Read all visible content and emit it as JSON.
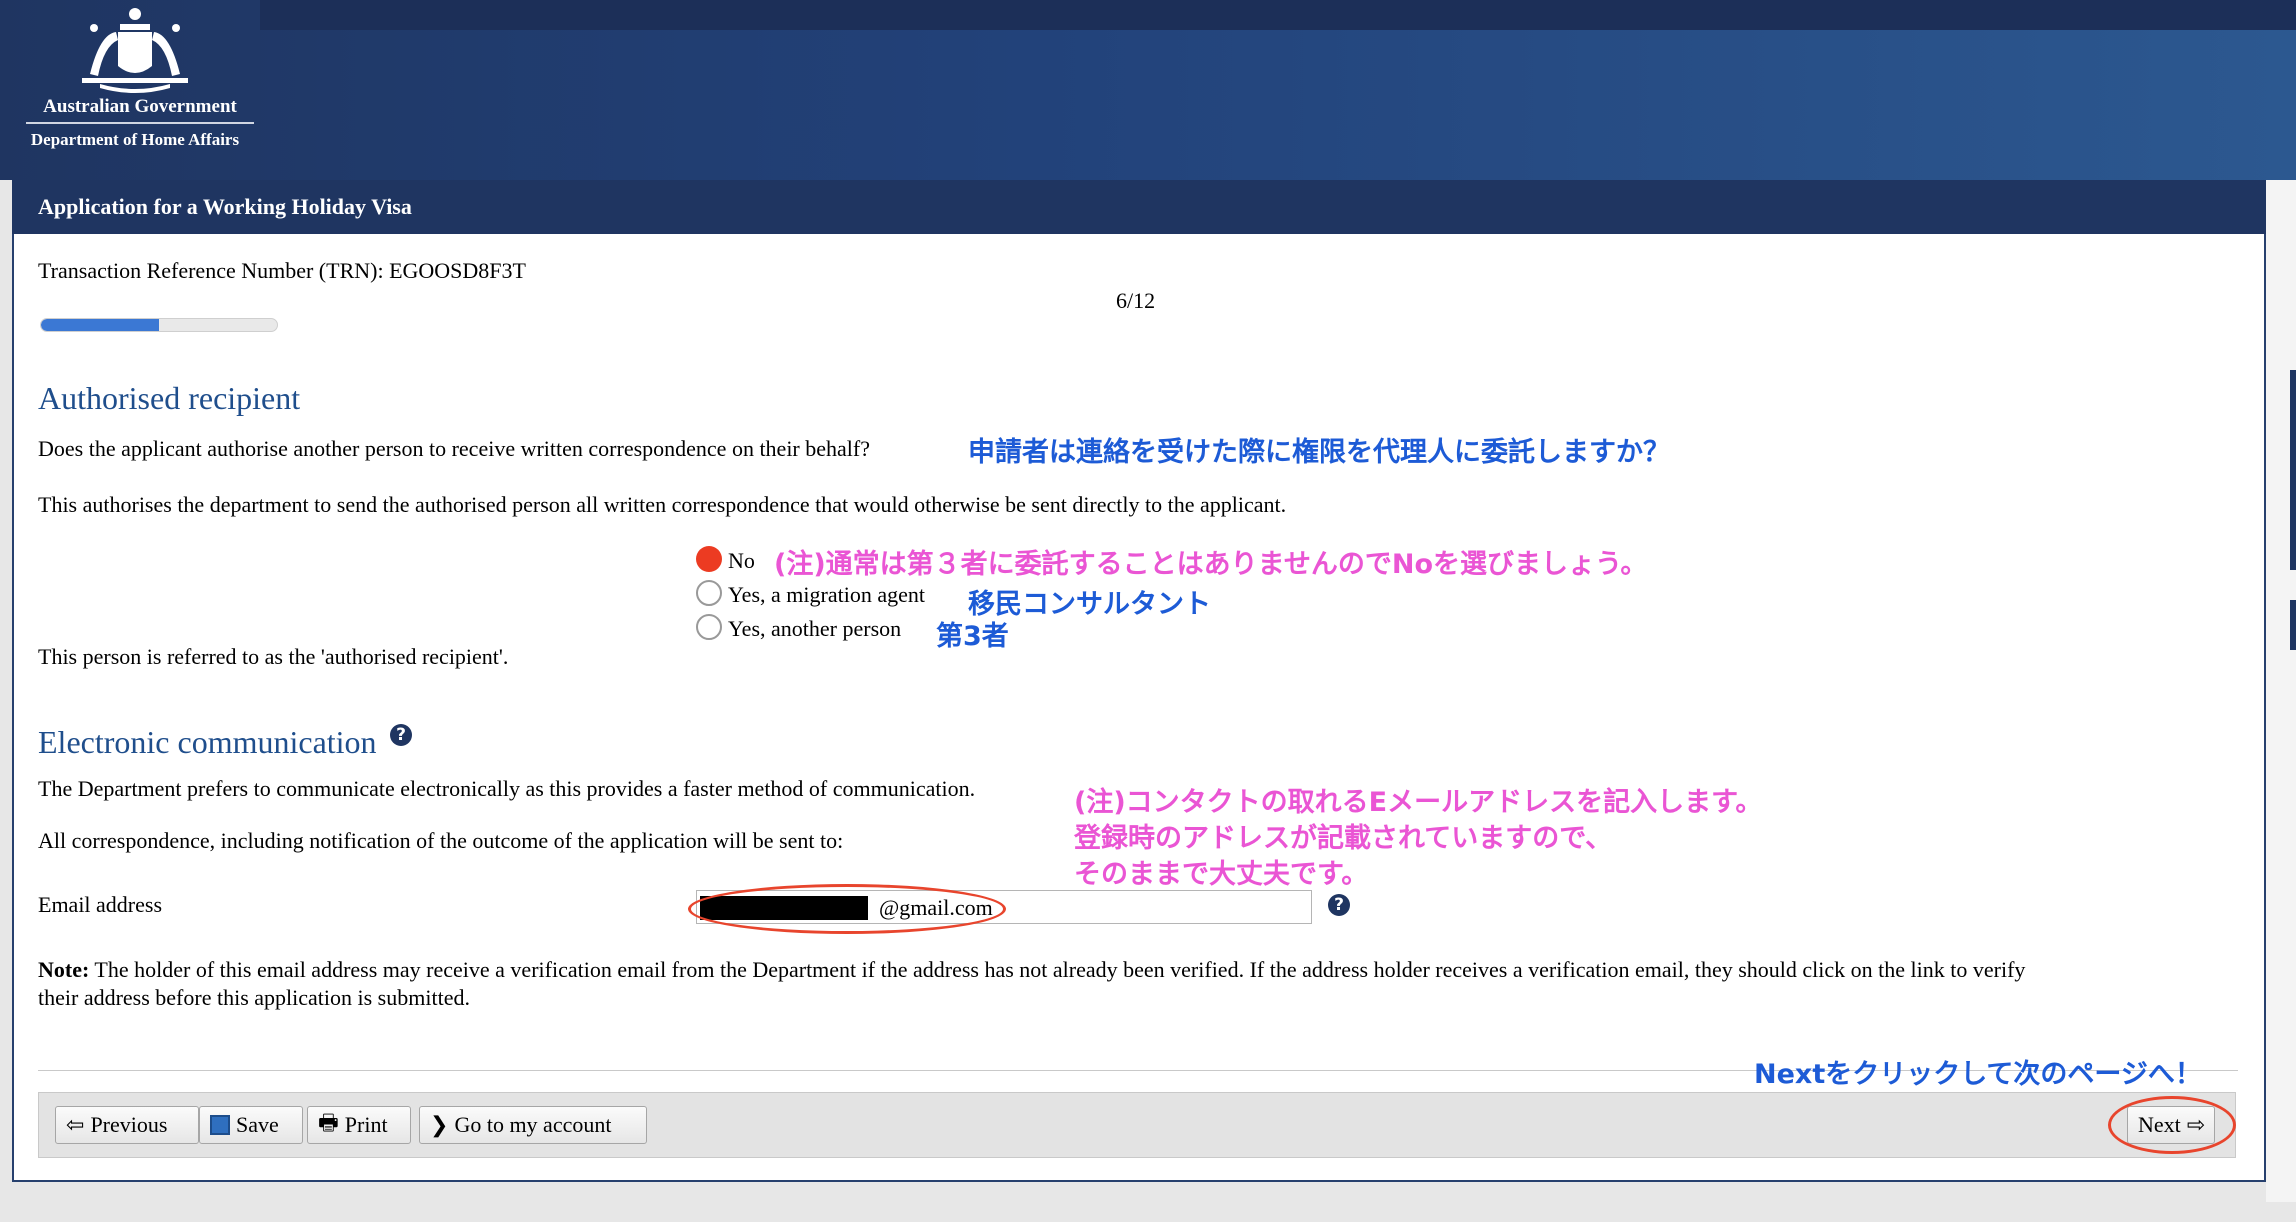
{
  "header": {
    "gov_name": "Australian Government",
    "dept_name": "Department of Home Affairs"
  },
  "page": {
    "title": "Application for a Working Holiday Visa",
    "trn": "Transaction Reference Number (TRN): EGOOSD8F3T",
    "step": "6/12",
    "progress_fraction": 0.5
  },
  "authorised": {
    "heading": "Authorised recipient",
    "question": "Does the applicant authorise another person to receive written correspondence on their behalf?",
    "explanation": "This authorises the department to send the authorised person all written correspondence that would otherwise be sent directly to the applicant.",
    "options": [
      {
        "label": "No",
        "checked": true
      },
      {
        "label": "Yes, a migration agent",
        "checked": false
      },
      {
        "label": "Yes, another person",
        "checked": false
      }
    ],
    "referred": "This person is referred to as the 'authorised recipient'."
  },
  "electronic": {
    "heading": "Electronic communication",
    "prefers": "The Department prefers to communicate electronically as this provides a faster method of communication.",
    "all_corr": "All correspondence, including notification of the outcome of the application will be sent to:",
    "email_label": "Email address",
    "email_value": "@gmail.com",
    "note_label": "Note:",
    "note_line1": "The holder of this email address may receive a verification email from the Department if the address has not already been verified. If the address holder receives a verification email, they should click on the link to verify",
    "note_line2": "their address before this application is submitted."
  },
  "annotations": {
    "question_jp": "申請者は連絡を受けた際に権限を代理人に委託しますか？",
    "no_jp": "(注)通常は第３者に委託することはありませんのでNoを選びましょう。",
    "agent_jp": "移民コンサルタント",
    "person_jp": "第3者",
    "email_jp_1": "(注)コンタクトの取れるEメールアドレスを記入します。",
    "email_jp_2": "登録時のアドレスが記載されていますので、",
    "email_jp_3": "そのままで大丈夫です。",
    "next_jp": "Nextをクリックして次のページへ！"
  },
  "footer": {
    "previous": "Previous",
    "save": "Save",
    "print": "Print",
    "account": "Go to my account",
    "next": "Next"
  },
  "colors": {
    "navy": "#1f3561",
    "heading_blue": "#1f4e8c",
    "annotation_blue": "#1d5bd6",
    "annotation_pink": "#ea55d4",
    "highlight_red": "#e8452d"
  },
  "icons": {
    "previous": "arrow-left-icon",
    "save": "floppy-disk-icon",
    "print": "printer-icon",
    "account": "chevron-right-icon",
    "next": "arrow-right-icon",
    "help": "question-circle-icon"
  }
}
